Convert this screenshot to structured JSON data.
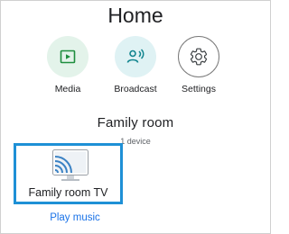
{
  "page": {
    "title": "Home"
  },
  "actions": [
    {
      "label": "Media",
      "icon": "media-icon"
    },
    {
      "label": "Broadcast",
      "icon": "broadcast-icon"
    },
    {
      "label": "Settings",
      "icon": "gear-icon"
    }
  ],
  "room": {
    "name": "Family room",
    "device_count": "1 device",
    "devices": [
      {
        "name": "Family room TV",
        "icon": "cast-tv-icon",
        "action": "Play music"
      }
    ]
  },
  "colors": {
    "accent": "#1a73e8",
    "selection": "#1e90d6",
    "media_bg": "#e3f3ea",
    "broadcast_bg": "#dff2f4",
    "icon_green": "#1e8e3e",
    "icon_teal": "#12858f"
  }
}
